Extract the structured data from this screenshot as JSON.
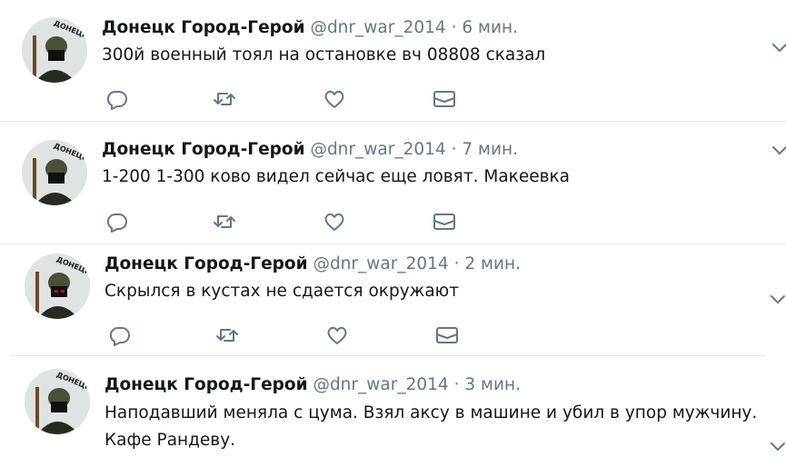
{
  "tweets": [
    {
      "name": "Донецк Город-Герой",
      "handle": "@dnr_war_2014",
      "dot": "·",
      "time": "6 мин.",
      "lines": [
        "300й военный тоял на остановке вч 08808 сказал"
      ]
    },
    {
      "name": "Донецк Город-Герой",
      "handle": "@dnr_war_2014",
      "dot": "·",
      "time": "7 мин.",
      "lines": [
        "1-200 1-300 ково видел сейчас еще ловят.  Макеевка"
      ]
    },
    {
      "name": "Донецк Город-Герой",
      "handle": "@dnr_war_2014",
      "dot": "·",
      "time": "2 мин.",
      "lines": [
        "Скрылся в кустах не сдается окружают"
      ]
    },
    {
      "name": "Донецк Город-Герой",
      "handle": "@dnr_war_2014",
      "dot": "·",
      "time": "3 мин.",
      "lines": [
        "Наподавший меняла с цума.  Взял аксу в машине и убил в упор мужчину.",
        "Кафе Рандеву."
      ]
    }
  ],
  "avatar_caption": "ДОНЕЦК",
  "colors": {
    "icon": "#657786",
    "name": "#14171a",
    "meta": "#657786",
    "separator": "#e6ecf0"
  },
  "icons": [
    "reply-icon",
    "retweet-icon",
    "like-icon",
    "message-icon",
    "chevron-down-icon"
  ]
}
